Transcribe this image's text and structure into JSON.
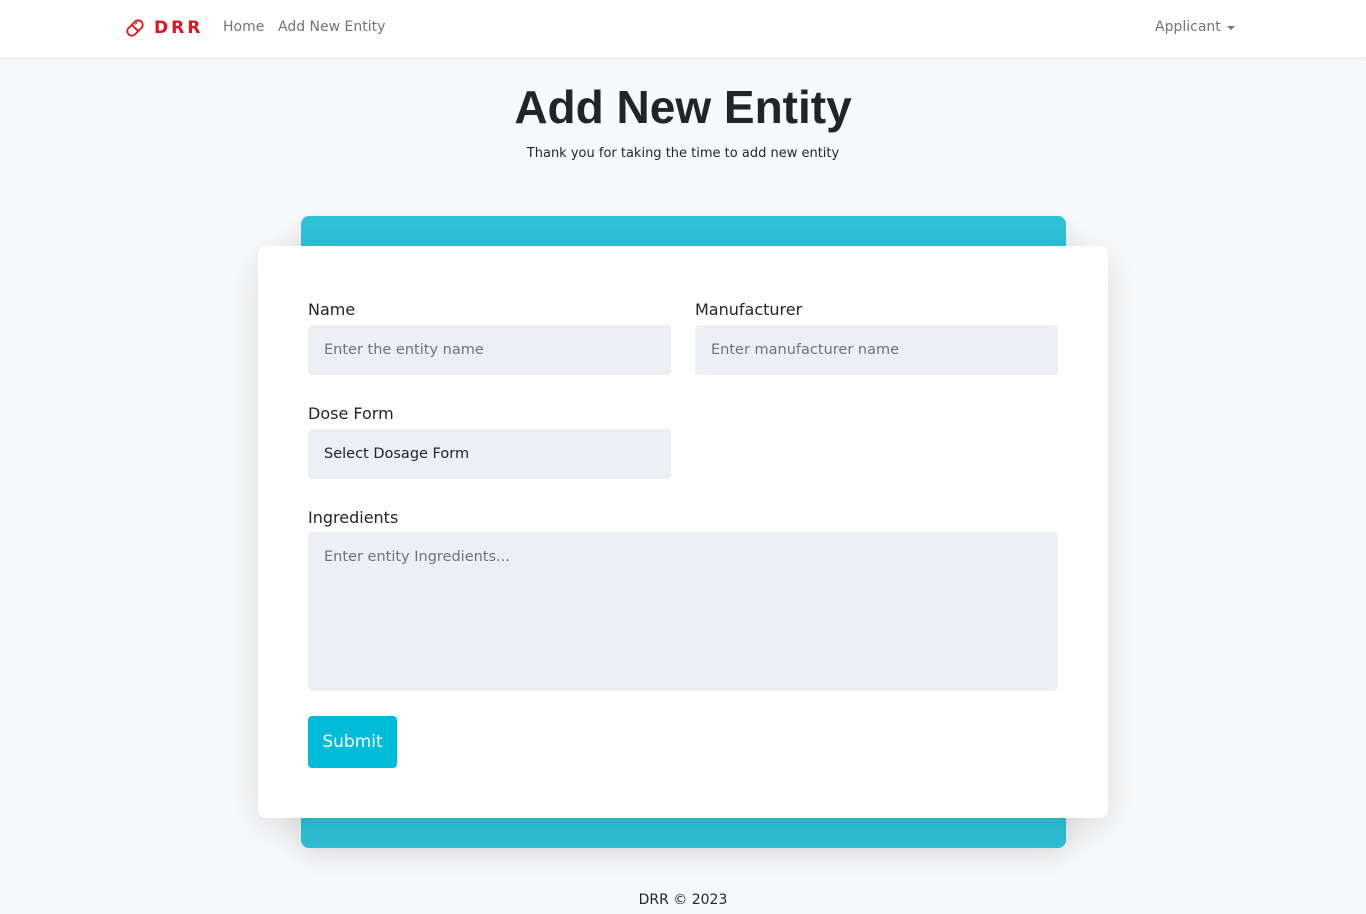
{
  "navbar": {
    "brand": "DRR",
    "brand_icon": "pill-icon",
    "brand_color": "#e0141f",
    "links": [
      {
        "label": "Home"
      },
      {
        "label": "Add New Entity"
      }
    ],
    "user_menu": "Applicant"
  },
  "header": {
    "title": "Add New Entity",
    "subtitle": "Thank you for taking the time to add new entity"
  },
  "form": {
    "name": {
      "label": "Name",
      "placeholder": "Enter the entity name",
      "value": ""
    },
    "manufacturer": {
      "label": "Manufacturer",
      "placeholder": "Enter manufacturer name",
      "value": ""
    },
    "dose_form": {
      "label": "Dose Form",
      "selected": "Select Dosage Form"
    },
    "ingredients": {
      "label": "Ingredients",
      "placeholder": "Enter entity Ingredients...",
      "value": ""
    },
    "submit_label": "Submit"
  },
  "colors": {
    "accent": "#00bcd9",
    "backdrop": "#2ec1d8",
    "input_bg": "#eceff3"
  },
  "footer": {
    "text": "DRR © 2023"
  }
}
